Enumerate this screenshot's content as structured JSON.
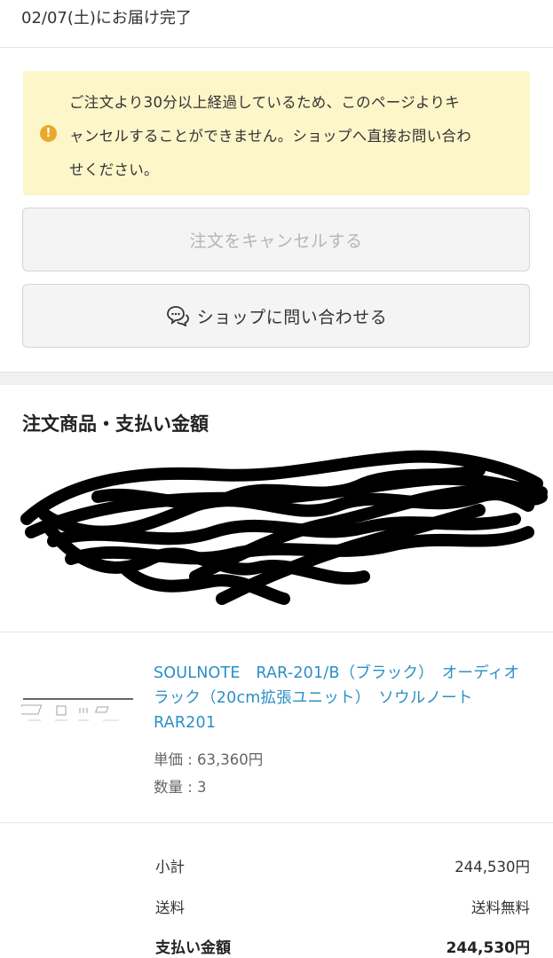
{
  "delivery_status": "02/07(土)にお届け完了",
  "notice": {
    "icon": "info-icon",
    "line1": "ご注文より30分以上経過しているため、このページよりキ",
    "line2": "ャンセルすることができません。ショップへ直接お問い合わ",
    "line3": "せください。"
  },
  "buttons": {
    "cancel_label": "注文をキャンセルする",
    "contact_label": "ショップに問い合わせる"
  },
  "section_title": "注文商品・支払い金額",
  "product": {
    "name": "SOULNOTE　RAR-201/B（ブラック）　オーディオラック（20cm拡張ユニット）　ソウルノート　RAR201",
    "unit_price": "単価 : 63,360円",
    "quantity": "数量 : 3"
  },
  "summary": {
    "subtotal_label": "小計",
    "subtotal_value": "244,530円",
    "shipping_label": "送料",
    "shipping_value": "送料無料",
    "total_label": "支払い金額",
    "total_value": "244,530円"
  },
  "colors": {
    "link": "#2b8fc5",
    "notice_bg": "#fcf6c9",
    "warn": "#e9aa2b"
  }
}
